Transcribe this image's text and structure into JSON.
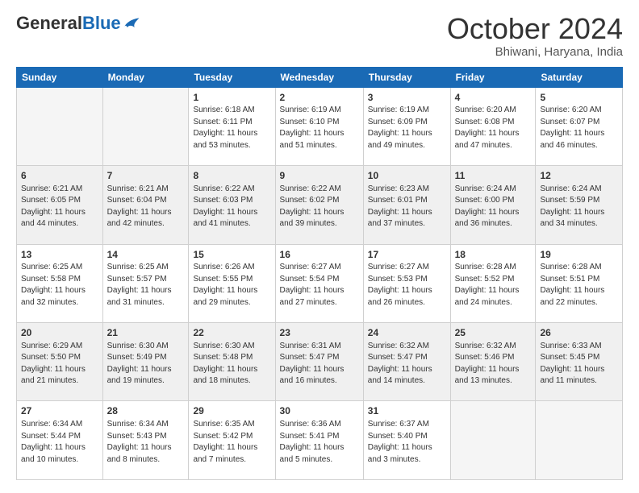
{
  "header": {
    "logo_general": "General",
    "logo_blue": "Blue",
    "month_title": "October 2024",
    "location": "Bhiwani, Haryana, India"
  },
  "calendar": {
    "days": [
      "Sunday",
      "Monday",
      "Tuesday",
      "Wednesday",
      "Thursday",
      "Friday",
      "Saturday"
    ],
    "rows": [
      [
        {
          "day": "",
          "sunrise": "",
          "sunset": "",
          "daylight": ""
        },
        {
          "day": "",
          "sunrise": "",
          "sunset": "",
          "daylight": ""
        },
        {
          "day": "1",
          "sunrise": "Sunrise: 6:18 AM",
          "sunset": "Sunset: 6:11 PM",
          "daylight": "Daylight: 11 hours and 53 minutes."
        },
        {
          "day": "2",
          "sunrise": "Sunrise: 6:19 AM",
          "sunset": "Sunset: 6:10 PM",
          "daylight": "Daylight: 11 hours and 51 minutes."
        },
        {
          "day": "3",
          "sunrise": "Sunrise: 6:19 AM",
          "sunset": "Sunset: 6:09 PM",
          "daylight": "Daylight: 11 hours and 49 minutes."
        },
        {
          "day": "4",
          "sunrise": "Sunrise: 6:20 AM",
          "sunset": "Sunset: 6:08 PM",
          "daylight": "Daylight: 11 hours and 47 minutes."
        },
        {
          "day": "5",
          "sunrise": "Sunrise: 6:20 AM",
          "sunset": "Sunset: 6:07 PM",
          "daylight": "Daylight: 11 hours and 46 minutes."
        }
      ],
      [
        {
          "day": "6",
          "sunrise": "Sunrise: 6:21 AM",
          "sunset": "Sunset: 6:05 PM",
          "daylight": "Daylight: 11 hours and 44 minutes."
        },
        {
          "day": "7",
          "sunrise": "Sunrise: 6:21 AM",
          "sunset": "Sunset: 6:04 PM",
          "daylight": "Daylight: 11 hours and 42 minutes."
        },
        {
          "day": "8",
          "sunrise": "Sunrise: 6:22 AM",
          "sunset": "Sunset: 6:03 PM",
          "daylight": "Daylight: 11 hours and 41 minutes."
        },
        {
          "day": "9",
          "sunrise": "Sunrise: 6:22 AM",
          "sunset": "Sunset: 6:02 PM",
          "daylight": "Daylight: 11 hours and 39 minutes."
        },
        {
          "day": "10",
          "sunrise": "Sunrise: 6:23 AM",
          "sunset": "Sunset: 6:01 PM",
          "daylight": "Daylight: 11 hours and 37 minutes."
        },
        {
          "day": "11",
          "sunrise": "Sunrise: 6:24 AM",
          "sunset": "Sunset: 6:00 PM",
          "daylight": "Daylight: 11 hours and 36 minutes."
        },
        {
          "day": "12",
          "sunrise": "Sunrise: 6:24 AM",
          "sunset": "Sunset: 5:59 PM",
          "daylight": "Daylight: 11 hours and 34 minutes."
        }
      ],
      [
        {
          "day": "13",
          "sunrise": "Sunrise: 6:25 AM",
          "sunset": "Sunset: 5:58 PM",
          "daylight": "Daylight: 11 hours and 32 minutes."
        },
        {
          "day": "14",
          "sunrise": "Sunrise: 6:25 AM",
          "sunset": "Sunset: 5:57 PM",
          "daylight": "Daylight: 11 hours and 31 minutes."
        },
        {
          "day": "15",
          "sunrise": "Sunrise: 6:26 AM",
          "sunset": "Sunset: 5:55 PM",
          "daylight": "Daylight: 11 hours and 29 minutes."
        },
        {
          "day": "16",
          "sunrise": "Sunrise: 6:27 AM",
          "sunset": "Sunset: 5:54 PM",
          "daylight": "Daylight: 11 hours and 27 minutes."
        },
        {
          "day": "17",
          "sunrise": "Sunrise: 6:27 AM",
          "sunset": "Sunset: 5:53 PM",
          "daylight": "Daylight: 11 hours and 26 minutes."
        },
        {
          "day": "18",
          "sunrise": "Sunrise: 6:28 AM",
          "sunset": "Sunset: 5:52 PM",
          "daylight": "Daylight: 11 hours and 24 minutes."
        },
        {
          "day": "19",
          "sunrise": "Sunrise: 6:28 AM",
          "sunset": "Sunset: 5:51 PM",
          "daylight": "Daylight: 11 hours and 22 minutes."
        }
      ],
      [
        {
          "day": "20",
          "sunrise": "Sunrise: 6:29 AM",
          "sunset": "Sunset: 5:50 PM",
          "daylight": "Daylight: 11 hours and 21 minutes."
        },
        {
          "day": "21",
          "sunrise": "Sunrise: 6:30 AM",
          "sunset": "Sunset: 5:49 PM",
          "daylight": "Daylight: 11 hours and 19 minutes."
        },
        {
          "day": "22",
          "sunrise": "Sunrise: 6:30 AM",
          "sunset": "Sunset: 5:48 PM",
          "daylight": "Daylight: 11 hours and 18 minutes."
        },
        {
          "day": "23",
          "sunrise": "Sunrise: 6:31 AM",
          "sunset": "Sunset: 5:47 PM",
          "daylight": "Daylight: 11 hours and 16 minutes."
        },
        {
          "day": "24",
          "sunrise": "Sunrise: 6:32 AM",
          "sunset": "Sunset: 5:47 PM",
          "daylight": "Daylight: 11 hours and 14 minutes."
        },
        {
          "day": "25",
          "sunrise": "Sunrise: 6:32 AM",
          "sunset": "Sunset: 5:46 PM",
          "daylight": "Daylight: 11 hours and 13 minutes."
        },
        {
          "day": "26",
          "sunrise": "Sunrise: 6:33 AM",
          "sunset": "Sunset: 5:45 PM",
          "daylight": "Daylight: 11 hours and 11 minutes."
        }
      ],
      [
        {
          "day": "27",
          "sunrise": "Sunrise: 6:34 AM",
          "sunset": "Sunset: 5:44 PM",
          "daylight": "Daylight: 11 hours and 10 minutes."
        },
        {
          "day": "28",
          "sunrise": "Sunrise: 6:34 AM",
          "sunset": "Sunset: 5:43 PM",
          "daylight": "Daylight: 11 hours and 8 minutes."
        },
        {
          "day": "29",
          "sunrise": "Sunrise: 6:35 AM",
          "sunset": "Sunset: 5:42 PM",
          "daylight": "Daylight: 11 hours and 7 minutes."
        },
        {
          "day": "30",
          "sunrise": "Sunrise: 6:36 AM",
          "sunset": "Sunset: 5:41 PM",
          "daylight": "Daylight: 11 hours and 5 minutes."
        },
        {
          "day": "31",
          "sunrise": "Sunrise: 6:37 AM",
          "sunset": "Sunset: 5:40 PM",
          "daylight": "Daylight: 11 hours and 3 minutes."
        },
        {
          "day": "",
          "sunrise": "",
          "sunset": "",
          "daylight": ""
        },
        {
          "day": "",
          "sunrise": "",
          "sunset": "",
          "daylight": ""
        }
      ]
    ]
  }
}
